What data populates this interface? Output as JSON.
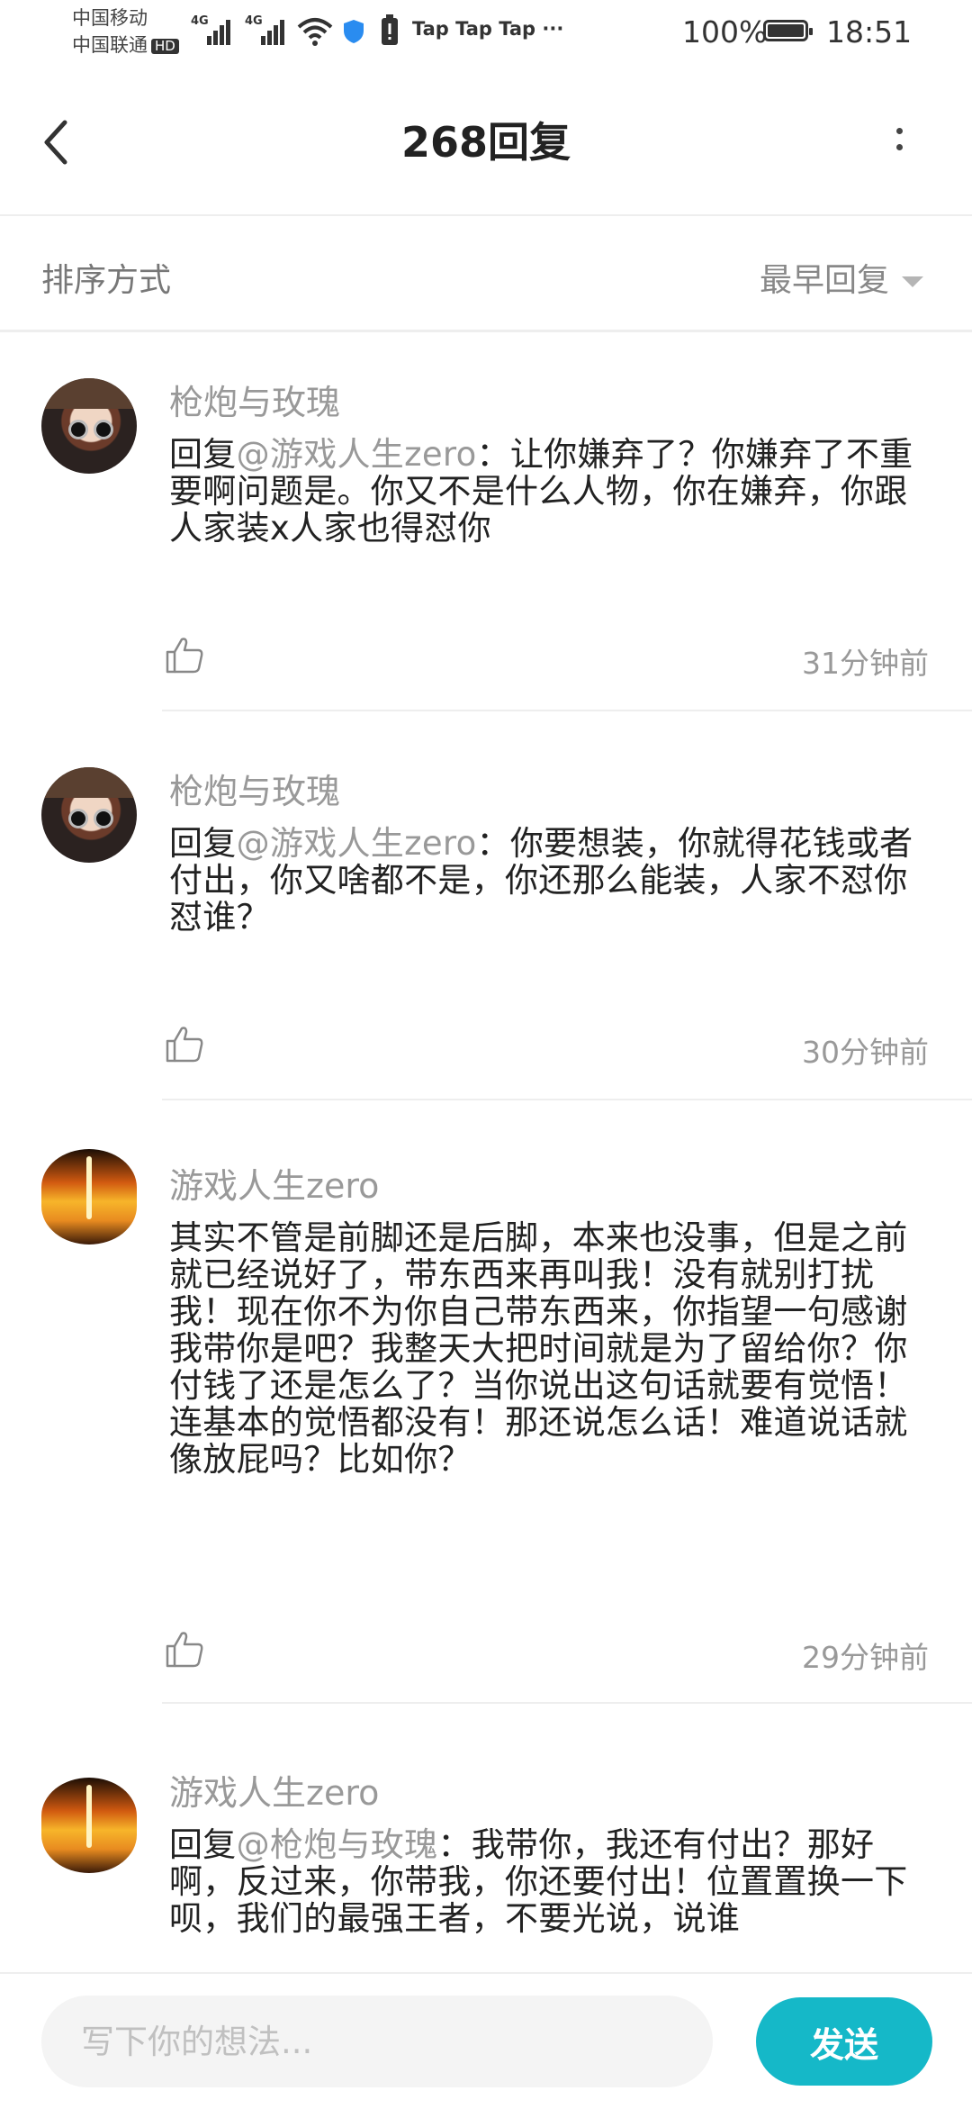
{
  "status_bar": {
    "carrier1": "中国移动",
    "carrier2": "中国联通",
    "hd": "HD",
    "signal_label": "4G",
    "apps": "Tap Tap Tap ···",
    "battery": "100%",
    "time": "18:51"
  },
  "header": {
    "title": "268回复"
  },
  "sort": {
    "label": "排序方式",
    "value": "最早回复"
  },
  "comments": [
    {
      "username": "枪炮与玫瑰",
      "prefix": "回复",
      "mention": "@游戏人生zero",
      "text": "：让你嫌弃了？你嫌弃了不重要啊问题是。你又不是什么人物，你在嫌弃，你跟人家装x人家也得怼你",
      "time": "31分钟前"
    },
    {
      "username": "枪炮与玫瑰",
      "prefix": "回复",
      "mention": "@游戏人生zero",
      "text": "：你要想装，你就得花钱或者付出，你又啥都不是，你还那么能装，人家不怼你怼谁？",
      "time": "30分钟前"
    },
    {
      "username": "游戏人生zero",
      "prefix": "",
      "mention": "",
      "text": "其实不管是前脚还是后脚，本来也没事，但是之前就已经说好了，带东西来再叫我！没有就别打扰我！现在你不为你自己带东西来，你指望一句感谢我带你是吧？我整天大把时间就是为了留给你？你付钱了还是怎么了？当你说出这句话就要有觉悟！连基本的觉悟都没有！那还说怎么话！难道说话就像放屁吗？比如你？",
      "time": "29分钟前"
    },
    {
      "username": "游戏人生zero",
      "prefix": "回复",
      "mention": "@枪炮与玫瑰",
      "text": "：我带你，我还有付出？那好啊，反过来，你带我，你还要付出！位置置换一下呗，我们的最强王者，不要光说，说谁",
      "time": ""
    }
  ],
  "composer": {
    "placeholder": "写下你的想法...",
    "send_label": "发送"
  }
}
